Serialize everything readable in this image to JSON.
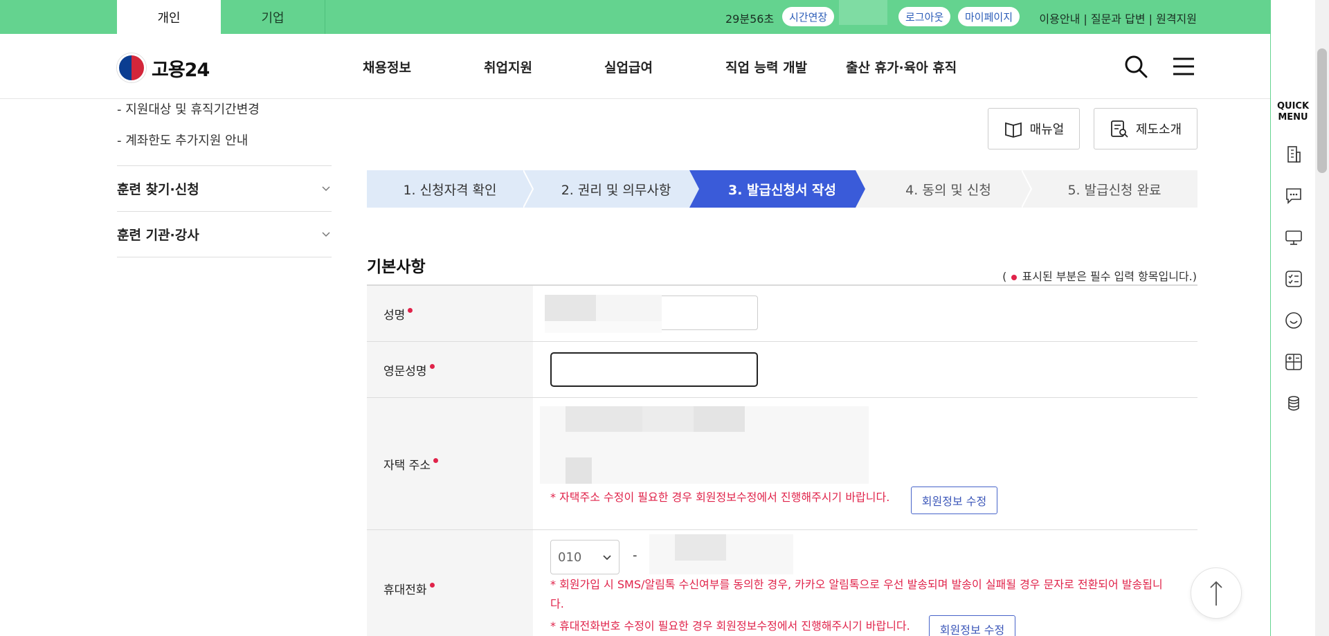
{
  "topbar": {
    "tabs": [
      {
        "label": "개인"
      },
      {
        "label": "기업"
      }
    ],
    "timer": "29분56초",
    "extend_label": "시간연장",
    "logout_label": "로그아웃",
    "mypage_label": "마이페이지",
    "links": "이용안내 | 질문과 답변 | 원격지원"
  },
  "header": {
    "logo_text": "고용24",
    "nav": [
      {
        "label": "채용정보"
      },
      {
        "label": "취업지원"
      },
      {
        "label": "실업급여"
      },
      {
        "label": "직업 능력 개발"
      },
      {
        "label": "출산 휴가·육아 휴직"
      }
    ],
    "search_icon": "search-icon",
    "menu_icon": "hamburger-menu-icon"
  },
  "lnb": {
    "subitems": [
      {
        "label": "- 지원대상 및 휴직기간변경"
      },
      {
        "label": "- 계좌한도 추가지원 안내"
      }
    ],
    "groups": [
      {
        "label": "훈련 찾기·신청"
      },
      {
        "label": "훈련 기관·강사"
      }
    ]
  },
  "actions": {
    "manual_label": "매뉴얼",
    "intro_label": "제도소개"
  },
  "stepper": {
    "steps": [
      {
        "label": "1. 신청자격 확인",
        "state": "done"
      },
      {
        "label": "2. 권리 및 의무사항",
        "state": "done"
      },
      {
        "label": "3. 발급신청서 작성",
        "state": "active"
      },
      {
        "label": "4. 동의 및 신청",
        "state": "todo"
      },
      {
        "label": "5. 발급신청 완료",
        "state": "todo"
      }
    ]
  },
  "section": {
    "title": "기본사항",
    "req_note_open": "(",
    "req_note_text": "표시된 부분은 필수 입력 항목입니다.)"
  },
  "form": {
    "name_label": "성명",
    "eng_name_label": "영문성명",
    "eng_name_value": "",
    "address_label": "자택 주소",
    "address_warn": "* 자택주소 수정이 필요한 경우 회원정보수정에서 진행해주시기 바랍니다.",
    "edit_member_label": "회원정보 수정",
    "phone_label": "휴대전화",
    "phone_prefix": "010",
    "phone_dash": "-",
    "phone_warn1": "* 회원가입 시 SMS/알림톡 수신여부를 동의한 경우, 카카오 알림톡으로 우선 발송되며 발송이 실패될 경우 문자로 전환되어 발송됩니",
    "phone_warn1b": "다.",
    "phone_warn2": "* 휴대전화번호 수정이 필요한 경우 회원정보수정에서 진행해주시기 바랍니다.",
    "edit_member_label2": "회원정보 수정"
  },
  "quick": {
    "title_line1": "QUICK",
    "title_line2": "MENU",
    "icons": [
      "building-icon",
      "chat-bubble-icon",
      "monitor-icon",
      "checklist-icon",
      "smile-icon",
      "calculator-icon",
      "coins-icon"
    ]
  },
  "colors": {
    "topbar": "#64d38f",
    "step_active": "#3a5bd9",
    "step_done": "#dfeaf8",
    "required": "#e0234a",
    "link_blue": "#3a55b8"
  }
}
